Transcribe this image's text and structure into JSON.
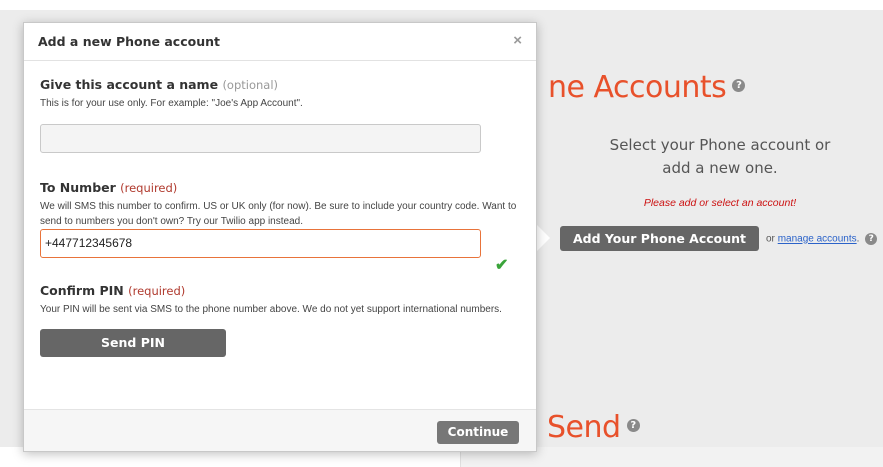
{
  "background": {
    "heading_top": "ne Accounts",
    "heading_bottom": "Send",
    "select_line1": "Select your Phone account or",
    "select_line2": "add a new one.",
    "warning": "Please add or select an account!",
    "add_account_button": "Add Your Phone Account",
    "or_text": "or",
    "manage_link": "manage accounts",
    "help_glyph": "?",
    "accent_color": "#e8512b"
  },
  "modal": {
    "title": "Add a new Phone account",
    "close": "×",
    "name_field": {
      "label": "Give this account a name",
      "hint": "(optional)",
      "description": "This is for your use only. For example: \"Joe's App Account\".",
      "value": ""
    },
    "number_field": {
      "label": "To Number",
      "hint": "(required)",
      "description": "We will SMS this number to confirm. US or UK only (for now). Be sure to include your country code. Want to send to numbers you don't own? Try our Twilio app instead.",
      "value": "+447712345678",
      "valid_icon": "check-icon"
    },
    "pin_field": {
      "label": "Confirm PIN",
      "hint": "(required)",
      "description": "Your PIN will be sent via SMS to the phone number above. We do not yet support international numbers.",
      "send_button": "Send PIN"
    },
    "continue_button": "Continue"
  }
}
